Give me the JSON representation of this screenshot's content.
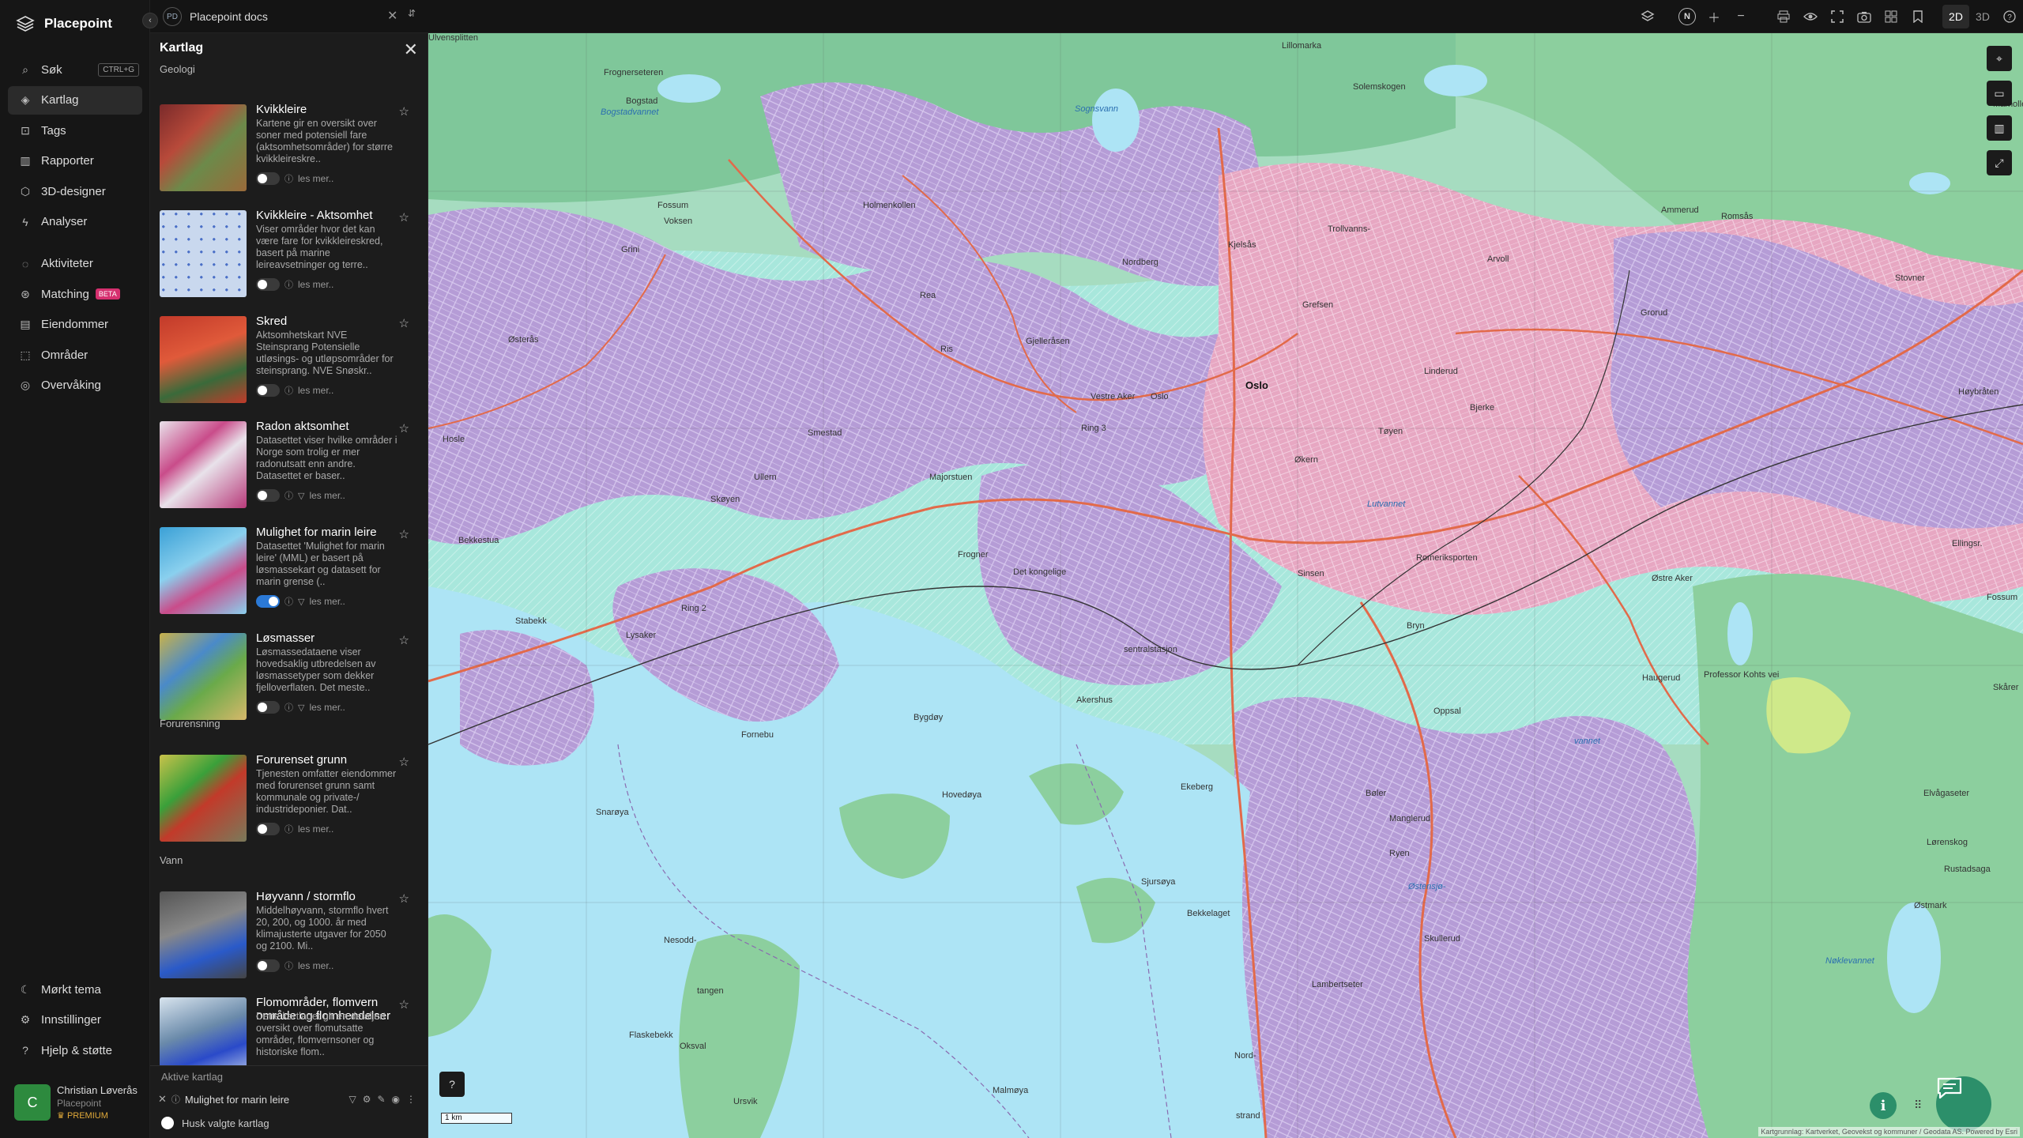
{
  "app": {
    "name": "Placepoint",
    "doc_badge": "PD",
    "doc_title": "Placepoint docs"
  },
  "topbar": {
    "north_label": "N",
    "mode_2d": "2D",
    "mode_3d": "3D"
  },
  "nav": {
    "items": [
      {
        "label": "Søk",
        "icon": "search-icon",
        "shortcut": "CTRL+G"
      },
      {
        "label": "Kartlag",
        "icon": "layers-icon",
        "active": true
      },
      {
        "label": "Tags",
        "icon": "bookmark-icon"
      },
      {
        "label": "Rapporter",
        "icon": "chart-icon"
      },
      {
        "label": "3D-designer",
        "icon": "cube-icon"
      },
      {
        "label": "Analyser",
        "icon": "bolt-icon"
      }
    ],
    "items2": [
      {
        "label": "Aktiviteter",
        "icon": "chat-icon"
      },
      {
        "label": "Matching",
        "icon": "match-icon",
        "badge": "BETA"
      },
      {
        "label": "Eiendommer",
        "icon": "building-icon"
      },
      {
        "label": "Områder",
        "icon": "area-icon"
      },
      {
        "label": "Overvåking",
        "icon": "monitor-icon"
      }
    ],
    "bottom": [
      {
        "label": "Mørkt tema",
        "icon": "moon-icon"
      },
      {
        "label": "Innstillinger",
        "icon": "gear-icon"
      },
      {
        "label": "Hjelp & støtte",
        "icon": "help-icon"
      }
    ],
    "user": {
      "initial": "C",
      "name": "Christian Løverås",
      "org": "Placepoint",
      "tier": "PREMIUM"
    }
  },
  "panel": {
    "title": "Kartlag",
    "sections": {
      "geologi": "Geologi",
      "forurensning": "Forurensning",
      "vann": "Vann"
    },
    "read_more": "les mer..",
    "layers": [
      {
        "title": "Kvikkleire",
        "desc": "Kartene gir en oversikt over soner med potensiell fare (aktsomhetsområder) for større kvikkleireskre..",
        "on": false
      },
      {
        "title": "Kvikkleire - Aktsomhet",
        "desc": "Viser områder hvor det kan være fare for kvikkleireskred, basert på marine leireavsetninger og terre..",
        "on": false
      },
      {
        "title": "Skred",
        "desc": "Aktsomhetskart NVE Steinsprang Potensielle utløsings- og utløpsområder for steinsprang. NVE Snøskr..",
        "on": false
      },
      {
        "title": "Radon aktsomhet",
        "desc": "Datasettet viser hvilke områder i Norge som trolig er mer radonutsatt enn andre. Datasettet er baser..",
        "on": false
      },
      {
        "title": "Mulighet for marin leire",
        "desc": "Datasettet 'Mulighet for marin leire' (MML) er basert på løsmassekart og datasett for marin grense (..",
        "on": true
      },
      {
        "title": "Løsmasser",
        "desc": "Løsmassedataene viser hovedsaklig utbredelsen av løsmassetyper som dekker fjelloverflaten. Det meste..",
        "on": false
      },
      {
        "title": "Forurenset grunn",
        "desc": "Tjenesten omfatter eiendommer med forurenset grunn samt kommunale og private-/ industrideponier. Dat..",
        "on": false
      },
      {
        "title": "Høyvann / stormflo",
        "desc": "Middelhøyvann, stormflo hvert 20, 200, og 1000. år med klimajusterte utgaver for 2050 og 2100. Mi..",
        "on": false
      },
      {
        "title": "Flomområder, flomvern område og flomhendelser",
        "desc": "Dette kartlaget gir en detaljert oversikt over flomutsatte områder, flomvernsoner og historiske flom..",
        "on": false
      }
    ],
    "active_label": "Aktive kartlag",
    "active_layer": "Mulighet for marin leire",
    "remember_label": "Husk valgte kartlag"
  },
  "map": {
    "scale": "1 km",
    "attribution": "Kartgrunnlag: Kartverket, Geovekst og kommuner / Geodata AS. Powered by Esri",
    "places": [
      {
        "t": "Oslo",
        "cls": "big"
      },
      {
        "t": "Oslo",
        "cls": ""
      },
      {
        "t": "Vestre Aker",
        "cls": ""
      },
      {
        "t": "Holmenkollen",
        "cls": ""
      },
      {
        "t": "Sognsvann",
        "cls": "water"
      },
      {
        "t": "Bogstadvannet",
        "cls": "water"
      },
      {
        "t": "Bogstad",
        "cls": ""
      },
      {
        "t": "Frognerseteren",
        "cls": ""
      },
      {
        "t": "Lillomarka",
        "cls": ""
      },
      {
        "t": "Solemskogen",
        "cls": ""
      },
      {
        "t": "Grefsen",
        "cls": ""
      },
      {
        "t": "Nordberg",
        "cls": ""
      },
      {
        "t": "Kjelsås",
        "cls": ""
      },
      {
        "t": "Trollvanns-",
        "cls": ""
      },
      {
        "t": "Ris",
        "cls": ""
      },
      {
        "t": "Rea",
        "cls": ""
      },
      {
        "t": "Fossum",
        "cls": ""
      },
      {
        "t": "Voksen",
        "cls": ""
      },
      {
        "t": "Grini",
        "cls": ""
      },
      {
        "t": "Østerås",
        "cls": ""
      },
      {
        "t": "Hosle",
        "cls": ""
      },
      {
        "t": "Bekkestua",
        "cls": ""
      },
      {
        "t": "Stabekk",
        "cls": ""
      },
      {
        "t": "Lysaker",
        "cls": ""
      },
      {
        "t": "Skøyen",
        "cls": ""
      },
      {
        "t": "Ullern",
        "cls": ""
      },
      {
        "t": "Smestad",
        "cls": ""
      },
      {
        "t": "Majorstuen",
        "cls": ""
      },
      {
        "t": "Frogner",
        "cls": ""
      },
      {
        "t": "Det kongelige",
        "cls": ""
      },
      {
        "t": "Akershus",
        "cls": ""
      },
      {
        "t": "sentralstasjon",
        "cls": ""
      },
      {
        "t": "Bygdøy",
        "cls": ""
      },
      {
        "t": "Fornebu",
        "cls": ""
      },
      {
        "t": "Snarøya",
        "cls": ""
      },
      {
        "t": "Hovedøya",
        "cls": ""
      },
      {
        "t": "Ekeberg",
        "cls": ""
      },
      {
        "t": "Sjursøya",
        "cls": ""
      },
      {
        "t": "Bekkelaget",
        "cls": ""
      },
      {
        "t": "Nesodd-",
        "cls": ""
      },
      {
        "t": "tangen",
        "cls": ""
      },
      {
        "t": "Flaskebekk",
        "cls": ""
      },
      {
        "t": "Oksval",
        "cls": ""
      },
      {
        "t": "Ursvik",
        "cls": ""
      },
      {
        "t": "Malmøya",
        "cls": ""
      },
      {
        "t": "Nord-",
        "cls": ""
      },
      {
        "t": "strand",
        "cls": ""
      },
      {
        "t": "Lambertseter",
        "cls": ""
      },
      {
        "t": "Skullerud",
        "cls": ""
      },
      {
        "t": "Bøler",
        "cls": ""
      },
      {
        "t": "Manglerud",
        "cls": ""
      },
      {
        "t": "Ryen",
        "cls": ""
      },
      {
        "t": "Østensjø-",
        "cls": "water"
      },
      {
        "t": "vannet",
        "cls": "water"
      },
      {
        "t": "Oppsal",
        "cls": ""
      },
      {
        "t": "Bryn",
        "cls": ""
      },
      {
        "t": "Østre Aker",
        "cls": ""
      },
      {
        "t": "Haugerud",
        "cls": ""
      },
      {
        "t": "Lutvannet",
        "cls": "water"
      },
      {
        "t": "Økern",
        "cls": ""
      },
      {
        "t": "Sinsen",
        "cls": ""
      },
      {
        "t": "Tøyen",
        "cls": ""
      },
      {
        "t": "Bjerke",
        "cls": ""
      },
      {
        "t": "Linderud",
        "cls": ""
      },
      {
        "t": "Arvoll",
        "cls": ""
      },
      {
        "t": "Ammerud",
        "cls": ""
      },
      {
        "t": "Grorud",
        "cls": ""
      },
      {
        "t": "Romsås",
        "cls": ""
      },
      {
        "t": "Stovner",
        "cls": ""
      },
      {
        "t": "Høybråten",
        "cls": ""
      },
      {
        "t": "Ellingsr.",
        "cls": ""
      },
      {
        "t": "Fossum",
        "cls": ""
      },
      {
        "t": "Skårer",
        "cls": ""
      },
      {
        "t": "Elvågaseter",
        "cls": ""
      },
      {
        "t": "Lørenskog",
        "cls": ""
      },
      {
        "t": "Østmark",
        "cls": ""
      },
      {
        "t": "Nøklevannet",
        "cls": "water"
      },
      {
        "t": "Rustadsaga",
        "cls": ""
      },
      {
        "t": "Marhollet",
        "cls": ""
      },
      {
        "t": "Gjelleråsen",
        "cls": ""
      },
      {
        "t": "Ring 3",
        "cls": ""
      },
      {
        "t": "Ring 2",
        "cls": ""
      },
      {
        "t": "Professor Kohts vei",
        "cls": ""
      },
      {
        "t": "Romeriksporten",
        "cls": ""
      },
      {
        "t": "Ulvensplitten",
        "cls": ""
      }
    ]
  }
}
